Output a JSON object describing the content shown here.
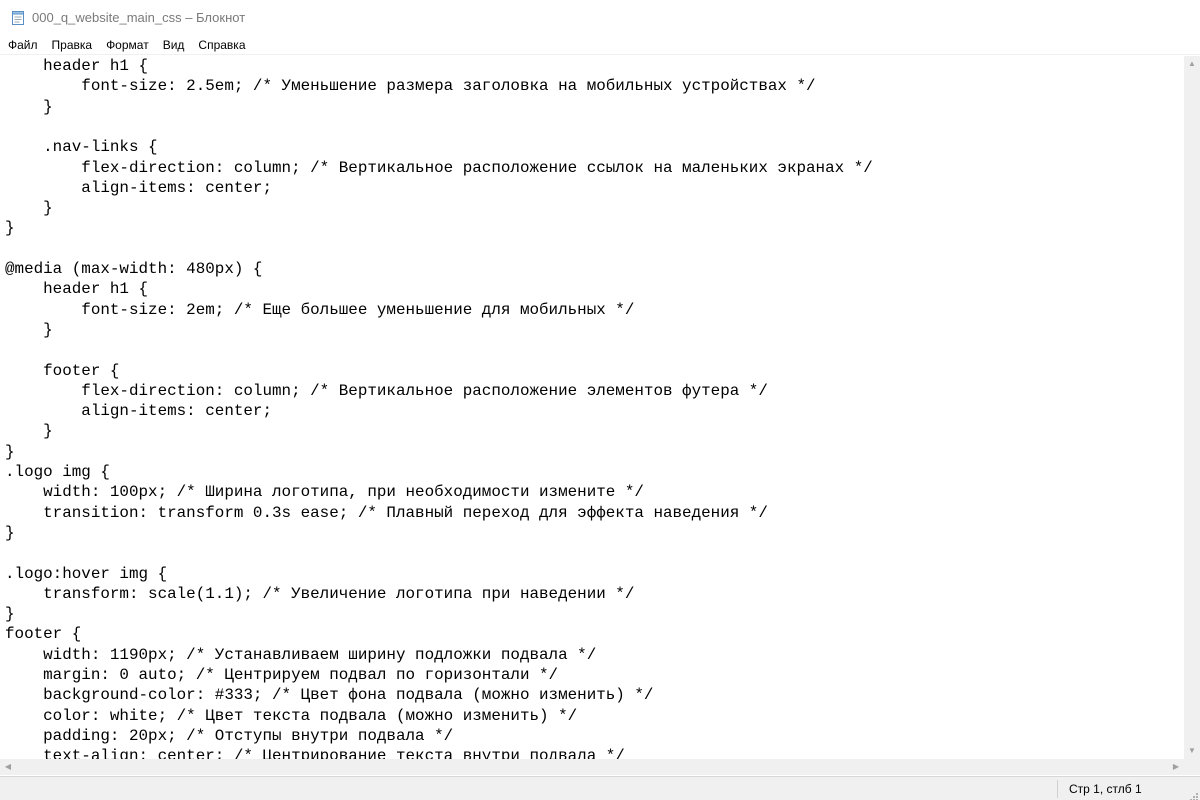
{
  "window": {
    "title": "000_q_website_main_css – Блокнот",
    "icon": "notepad-icon"
  },
  "menu": [
    {
      "label": "Файл"
    },
    {
      "label": "Правка"
    },
    {
      "label": "Формат"
    },
    {
      "label": "Вид"
    },
    {
      "label": "Справка"
    }
  ],
  "editor": {
    "lines": [
      "    header h1 {",
      "        font-size: 2.5em; /* Уменьшение размера заголовка на мобильных устройствах */",
      "    }",
      "",
      "    .nav-links {",
      "        flex-direction: column; /* Вертикальное расположение ссылок на маленьких экранах */",
      "        align-items: center;",
      "    }",
      "}",
      "",
      "@media (max-width: 480px) {",
      "    header h1 {",
      "        font-size: 2em; /* Еще большее уменьшение для мобильных */",
      "    }",
      "",
      "    footer {",
      "        flex-direction: column; /* Вертикальное расположение элементов футера */",
      "        align-items: center;",
      "    }",
      "}",
      ".logo img {",
      "    width: 100px; /* Ширина логотипа, при необходимости измените */",
      "    transition: transform 0.3s ease; /* Плавный переход для эффекта наведения */",
      "}",
      "",
      ".logo:hover img {",
      "    transform: scale(1.1); /* Увеличение логотипа при наведении */",
      "}",
      "footer {",
      "    width: 1190px; /* Устанавливаем ширину подложки подвала */",
      "    margin: 0 auto; /* Центрируем подвал по горизонтали */",
      "    background-color: #333; /* Цвет фона подвала (можно изменить) */",
      "    color: white; /* Цвет текста подвала (можно изменить) */",
      "    padding: 20px; /* Отступы внутри подвала */",
      "    text-align: center; /* Центрирование текста внутри подвала */"
    ]
  },
  "statusbar": {
    "position": "Стр 1, стлб 1"
  },
  "colors": {
    "window_bg": "#ffffff",
    "chrome_bg": "#f0f0f0",
    "title_text": "#7a7a7a"
  }
}
